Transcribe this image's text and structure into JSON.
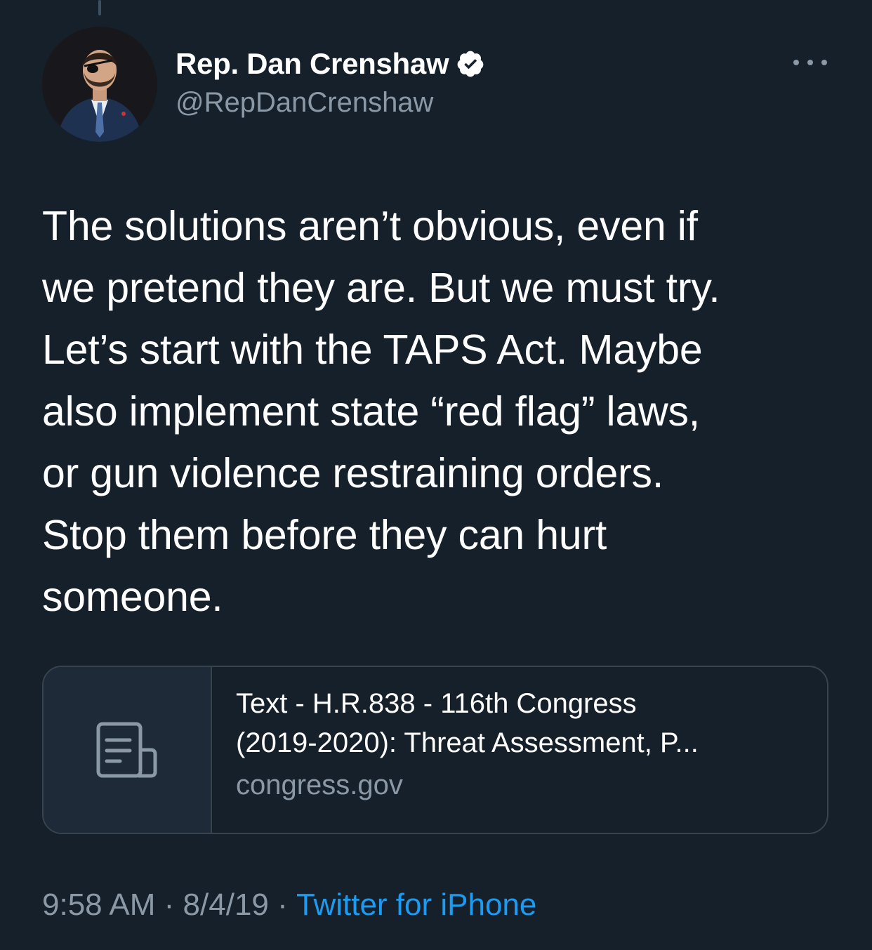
{
  "author": {
    "display_name": "Rep. Dan Crenshaw",
    "handle": "@RepDanCrenshaw",
    "verified": true,
    "avatar_icon": "profile-photo"
  },
  "tweet": {
    "text": "The solutions aren’t obvious, even if\nwe pretend they are. But we must try.\nLet’s start with the TAPS Act. Maybe\nalso implement state “red flag” laws,\nor gun violence restraining orders.\nStop them before they can hurt\nsomeone."
  },
  "link_card": {
    "icon": "document-icon",
    "title": "Text - H.R.838 - 116th Congress\n(2019-2020): Threat Assessment, P...",
    "domain": "congress.gov"
  },
  "meta": {
    "time": "9:58 AM",
    "separator": " · ",
    "date": "8/4/19",
    "source": "Twitter for iPhone"
  },
  "colors": {
    "background": "#15202b",
    "secondary_text": "#8b98a5",
    "accent": "#1d9bf0"
  }
}
